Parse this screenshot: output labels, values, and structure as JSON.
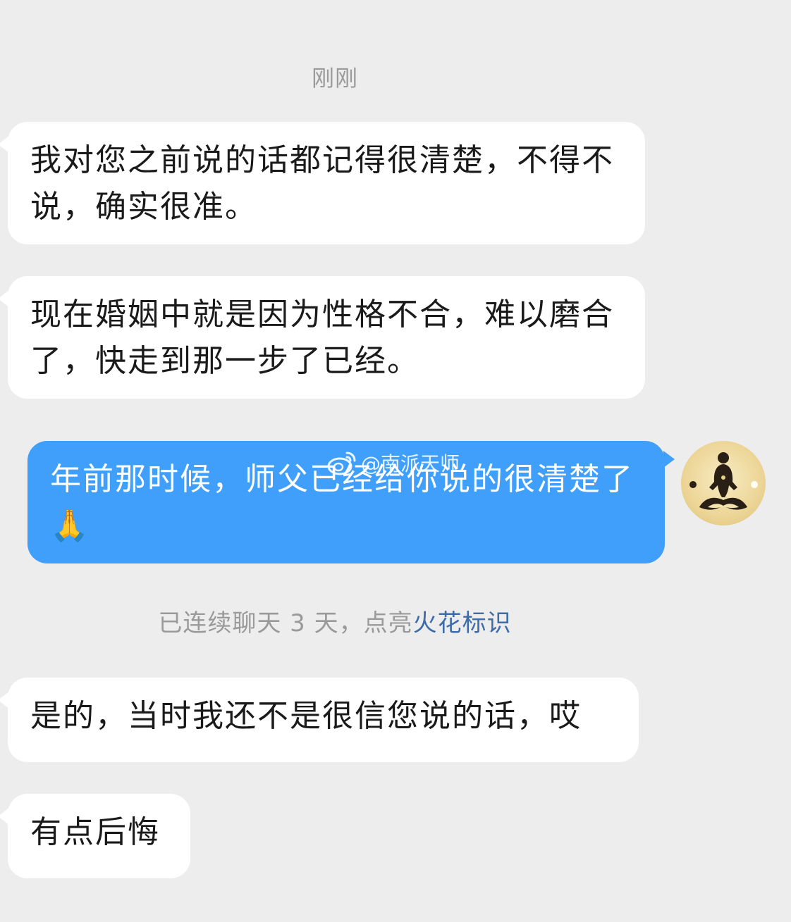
{
  "timestamp": "刚刚",
  "messages": [
    {
      "from": "other",
      "text": "我对您之前说的话都记得很清楚，不得不说，确实很准。"
    },
    {
      "from": "other",
      "text": "现在婚姻中就是因为性格不合，难以磨合了，快走到那一步了已经。"
    },
    {
      "from": "self",
      "text": "年前那时候，师父已经给你说的很清楚了🙏"
    },
    {
      "from": "other",
      "text": "是的，当时我还不是很信您说的话，哎"
    },
    {
      "from": "other",
      "text": "有点后悔"
    }
  ],
  "system_note": {
    "prefix": "已连续聊天 3 天，点亮",
    "link": "火花标识"
  },
  "watermark": "@南派天师",
  "colors": {
    "background": "#ededed",
    "incoming_bubble": "#ffffff",
    "outgoing_bubble": "#3f9ffb",
    "link": "#3e6ca8"
  },
  "icons": {
    "avatar": "meditating-figure-avatar",
    "watermark": "weibo-icon"
  }
}
